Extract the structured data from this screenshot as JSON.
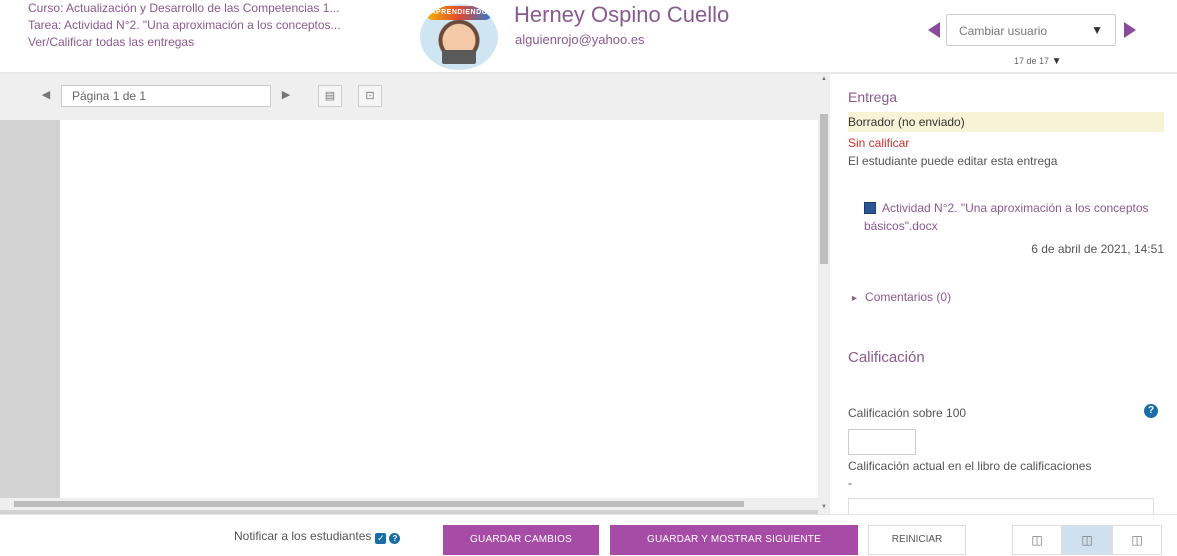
{
  "header": {
    "course_line": "Curso: Actualización y Desarrollo de las Competencias 1...",
    "task_line": "Tarea: Actividad N°2. \"Una aproximación a los conceptos...",
    "view_all_link": "Ver/Calificar todas las entregas",
    "avatar_banner": "APRENDIENDO",
    "user_name": "Herney Ospino Cuello",
    "user_email": "alguienrojo@yahoo.es",
    "user_select_placeholder": "Cambiar usuario",
    "user_count": "17 de 17"
  },
  "editor": {
    "page_select": "Página 1 de 1"
  },
  "submission": {
    "title": "Entrega",
    "status": "Borrador (no enviado)",
    "grading_status": "Sin calificar",
    "edit_note": "El estudiante puede editar esta entrega",
    "file_name": "Actividad N°2. \"Una aproximación a los conceptos básicos\".docx",
    "file_date": "6 de abril de 2021, 14:51",
    "comments": "Comentarios (0)",
    "colors": {
      "status_bg": "#f7f3d6",
      "ungraded": "#c9302c",
      "accent": "#8a5a8f"
    }
  },
  "grading": {
    "title": "Calificación",
    "grade_label": "Calificación sobre 100",
    "current_label": "Calificación actual en el libro de calificaciones",
    "current_value": "-"
  },
  "footer": {
    "notify_label": "Notificar a los estudiantes",
    "save_label": "GUARDAR CAMBIOS",
    "save_next_label": "GUARDAR Y MOSTRAR SIGUIENTE",
    "reset_label": "REINICIAR",
    "button_color": "#a64ca6"
  }
}
